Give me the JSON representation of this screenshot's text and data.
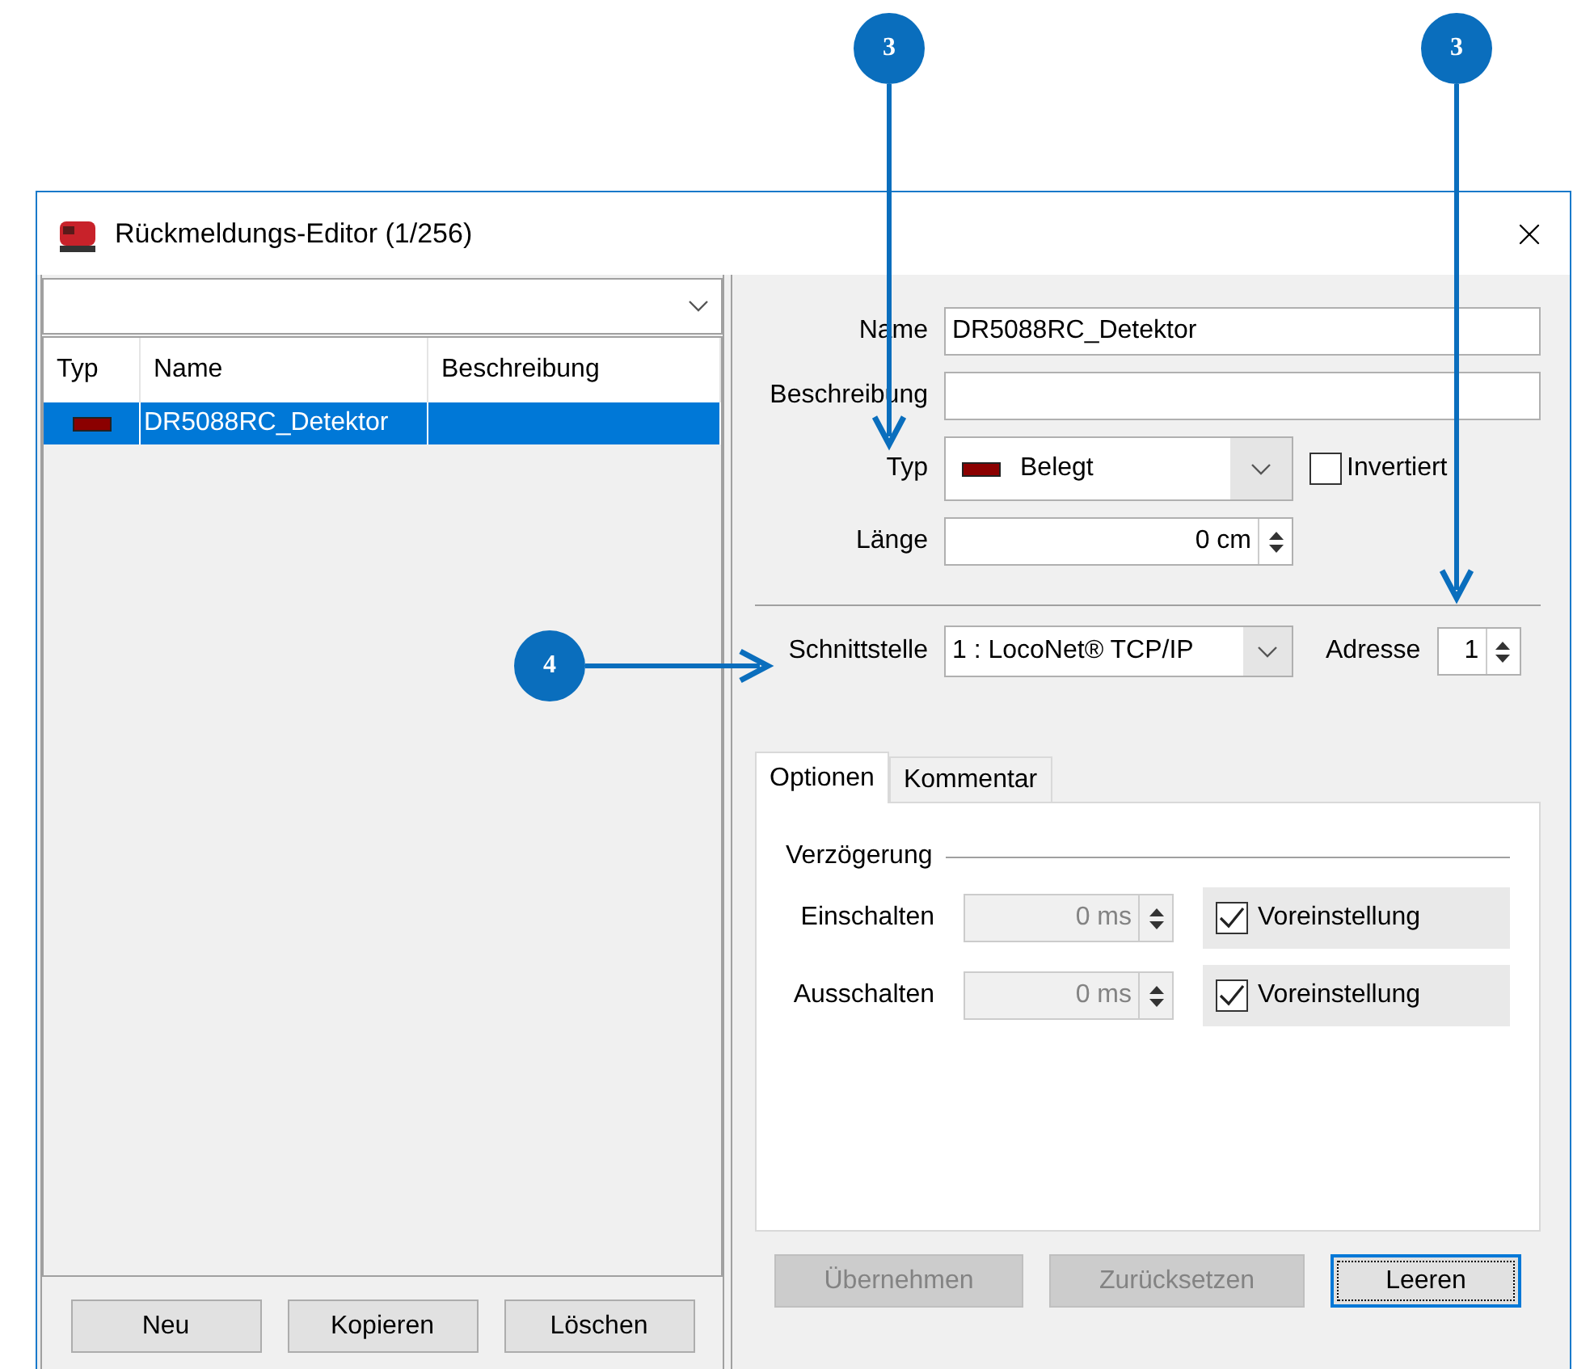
{
  "callouts": [
    {
      "number": "3"
    },
    {
      "number": "3"
    },
    {
      "number": "4"
    }
  ],
  "window": {
    "title": "Rückmeldungs-Editor (1/256)"
  },
  "list": {
    "columns": [
      "Typ",
      "Name",
      "Beschreibung"
    ],
    "rows": [
      {
        "name": "DR5088RC_Detektor",
        "selected": true
      }
    ]
  },
  "list_buttons": [
    {
      "label": "Neu",
      "disabled": false,
      "focused": false
    },
    {
      "label": "Kopieren",
      "disabled": false,
      "focused": false
    },
    {
      "label": "Löschen",
      "disabled": false,
      "focused": false
    }
  ],
  "form": {
    "name_label": "Name",
    "name_value": "DR5088RC_Detektor",
    "description_label": "Beschreibung",
    "type_label": "Typ",
    "type_value": "Belegt",
    "inverted_label": "Invertiert",
    "inverted_checked": false,
    "length_label": "Länge",
    "length_value": "0 cm",
    "interface_label": "Schnittstelle",
    "interface_value": "1 : LocoNet® TCP/IP",
    "address_label": "Adresse",
    "address_value": "1"
  },
  "tabs": [
    {
      "label": "Optionen",
      "selected": true
    },
    {
      "label": "Kommentar",
      "selected": false
    }
  ],
  "delay": {
    "title": "Verzögerung",
    "rows": [
      {
        "label": "Einschalten",
        "value": "0 ms",
        "default_label": "Voreinstellung",
        "checked": true
      },
      {
        "label": "Ausschalten",
        "value": "0 ms",
        "default_label": "Voreinstellung",
        "checked": true
      }
    ]
  },
  "action_buttons": [
    {
      "label": "Übernehmen",
      "disabled": true,
      "focused": false
    },
    {
      "label": "Zurücksetzen",
      "disabled": true,
      "focused": false
    },
    {
      "label": "Leeren",
      "disabled": false,
      "focused": true
    }
  ]
}
